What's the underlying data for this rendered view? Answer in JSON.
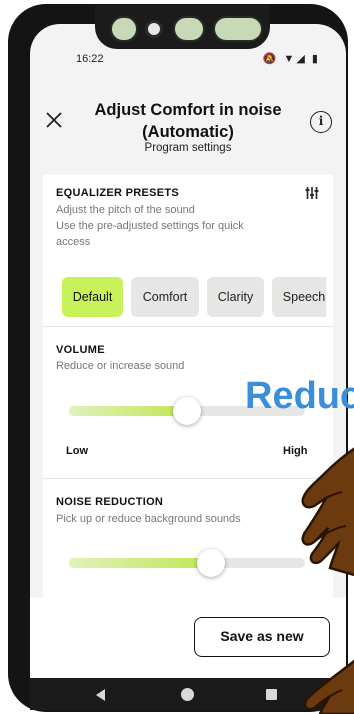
{
  "status_bar": {
    "time": "16:22",
    "icons": "🔕 ▼◢ ▮"
  },
  "header": {
    "title_line1": "Adjust Comfort in noise",
    "title_line2": "(Automatic)",
    "subtitle": "Program settings",
    "info_glyph": "i"
  },
  "equalizer": {
    "title": "EQUALIZER PRESETS",
    "desc_line1": "Adjust the pitch of the sound",
    "desc_line2": "Use the pre-adjusted settings for quick",
    "desc_line3": "access",
    "presets": [
      "Default",
      "Comfort",
      "Clarity",
      "Speech"
    ],
    "selected": "Default"
  },
  "volume": {
    "title": "VOLUME",
    "desc": "Reduce or increase sound",
    "low_label": "Low",
    "high_label": "High",
    "level": 0.5
  },
  "noise_reduction": {
    "title": "NOISE REDUCTION",
    "desc": "Pick up or reduce background sounds",
    "level": 0.6
  },
  "actions": {
    "save_label": "Save as new"
  },
  "overlay": {
    "text": "Reduc"
  },
  "colors": {
    "accent": "#c9f25a",
    "overlay_text": "#3a8fd8",
    "hand": "#6b3a0e"
  }
}
